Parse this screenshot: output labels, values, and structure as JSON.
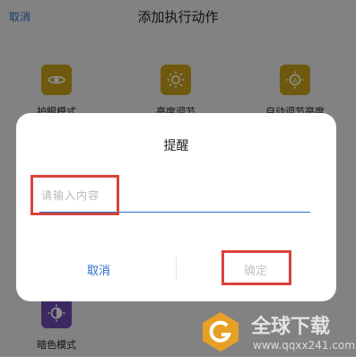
{
  "header": {
    "cancel_label": "取消",
    "title": "添加执行动作"
  },
  "tiles": [
    {
      "label": "护眼模式",
      "icon": "eye-icon"
    },
    {
      "label": "亮度调节",
      "icon": "sun-icon"
    },
    {
      "label": "自动调节亮度",
      "icon": "auto-brightness-icon"
    },
    {
      "label": "暗色模式",
      "icon": "dark-mode-icon"
    }
  ],
  "dialog": {
    "title": "提醒",
    "input_placeholder": "请输入内容",
    "cancel_label": "取消",
    "confirm_label": "确定"
  },
  "watermark": {
    "text": "全球下载",
    "url": "www.qqxx241.com"
  },
  "colors": {
    "accent": "#2a6fc9",
    "tile_gold": "#c9a21a",
    "tile_purple": "#6d4bb5",
    "highlight": "#d9423d"
  }
}
